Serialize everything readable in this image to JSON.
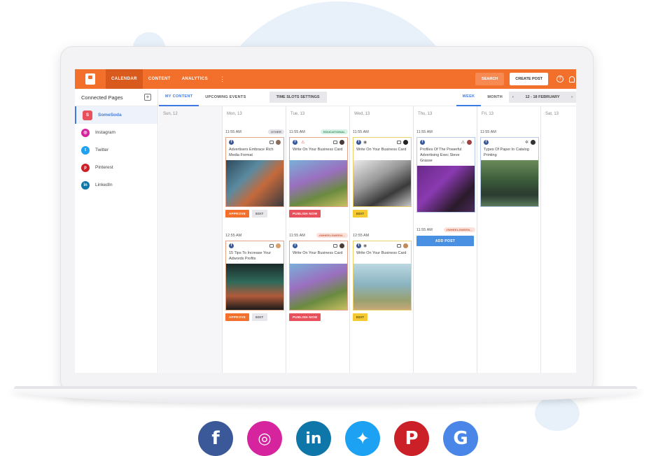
{
  "nav": {
    "items": [
      "CALENDAR",
      "CONTENT",
      "ANALYTICS"
    ],
    "search_label": "SEARCH",
    "create_label": "CREATE POST",
    "help": "?"
  },
  "sidebar": {
    "title": "Connected Pages",
    "items": [
      {
        "label": "SomeSoda",
        "icon": "somesoda-avatar",
        "color": "#e8505b"
      },
      {
        "label": "Instagram",
        "icon": "instagram-icon",
        "color": "#d6249f"
      },
      {
        "label": "Twitter",
        "icon": "twitter-icon",
        "color": "#1da1f2"
      },
      {
        "label": "Pinterest",
        "icon": "pinterest-icon",
        "color": "#cb2027"
      },
      {
        "label": "LinkedIn",
        "icon": "linkedin-icon",
        "color": "#0e76a8"
      }
    ]
  },
  "tabs": {
    "my_content": "MY CONTENT",
    "upcoming": "UPCOMING EVENTS",
    "time_slots": "TIME SLOTS SETTINGS",
    "week": "WEEK",
    "month": "MONTH",
    "range": "12 - 18 FEBRUARY"
  },
  "days": [
    "Sun, 12",
    "Mon, 13",
    "Tue, 13",
    "Wed, 13",
    "Thu, 13",
    "Fri, 13",
    "Sat, 13"
  ],
  "posts": {
    "mon1": {
      "time": "11:55 AM",
      "tag": "OTHER",
      "title": "Advertisers Embrace Rich Media Format",
      "a1": "APPROVE",
      "a2": "EDIT"
    },
    "mon2": {
      "time": "12:55 AM",
      "title": "15 Tips To Increase Your Adwords Profits",
      "a1": "APPROVE",
      "a2": "EDIT"
    },
    "tue1": {
      "time": "11:55 AM",
      "tag": "EDUCATIONAL",
      "title": "Write On Your Business Card",
      "a1": "PUBLISH NOW"
    },
    "tue2": {
      "time": "11:55 AM",
      "tag": "#WHEELSWEEN...",
      "title": "Write On Your Business Card",
      "a1": "PUBLISH NOW"
    },
    "wed1": {
      "time": "11:55 AM",
      "title": "Write On Your Business Card",
      "a1": "EDIT"
    },
    "wed2": {
      "time": "12:55 AM",
      "title": "Write On Your Business Card",
      "a1": "EDIT"
    },
    "thu1": {
      "time": "11:55 AM",
      "title": "Profiles Of The Powerful Advertising Exec Steve Grasse"
    },
    "thu2": {
      "time": "11:55 AM",
      "tag": "#WHEELSWEEN...",
      "add": "ADD POST"
    },
    "fri1": {
      "time": "11:55 AM",
      "title": "Types Of Paper In Catalog Printing"
    }
  },
  "social_icons": [
    "facebook-icon",
    "instagram-icon",
    "linkedin-icon",
    "twitter-icon",
    "pinterest-icon",
    "google-icon"
  ],
  "colors": {
    "brand": "#f26f2c",
    "accent": "#3e7be0"
  }
}
